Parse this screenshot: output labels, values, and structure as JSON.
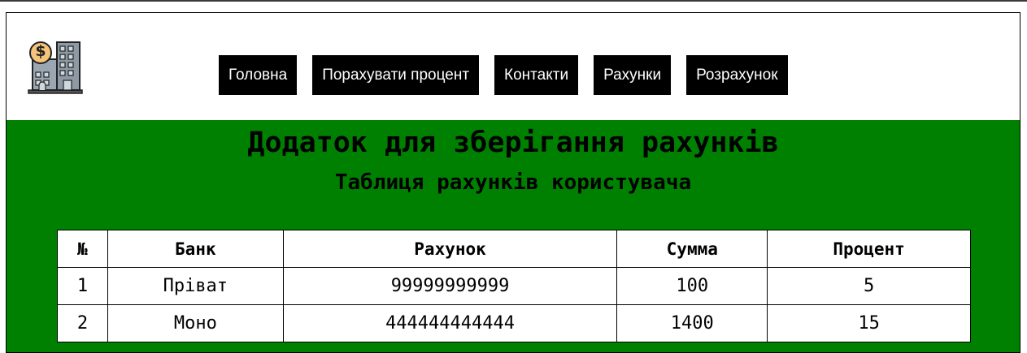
{
  "nav": {
    "items": [
      "Головна",
      "Порахувати процент",
      "Контакти",
      "Рахунки",
      "Розрахунок"
    ]
  },
  "logo": {
    "icon": "bank-building-icon",
    "symbol": "$"
  },
  "main": {
    "title": "Додаток для зберігання рахунків",
    "subtitle": "Таблиця рахунків користувача",
    "background": "#008000"
  },
  "table": {
    "headers": [
      "№",
      "Банк",
      "Рахунок",
      "Сумма",
      "Процент"
    ],
    "rows": [
      [
        "1",
        "Пріват",
        "99999999999",
        "100",
        "5"
      ],
      [
        "2",
        "Моно",
        "444444444444",
        "1400",
        "15"
      ]
    ]
  }
}
